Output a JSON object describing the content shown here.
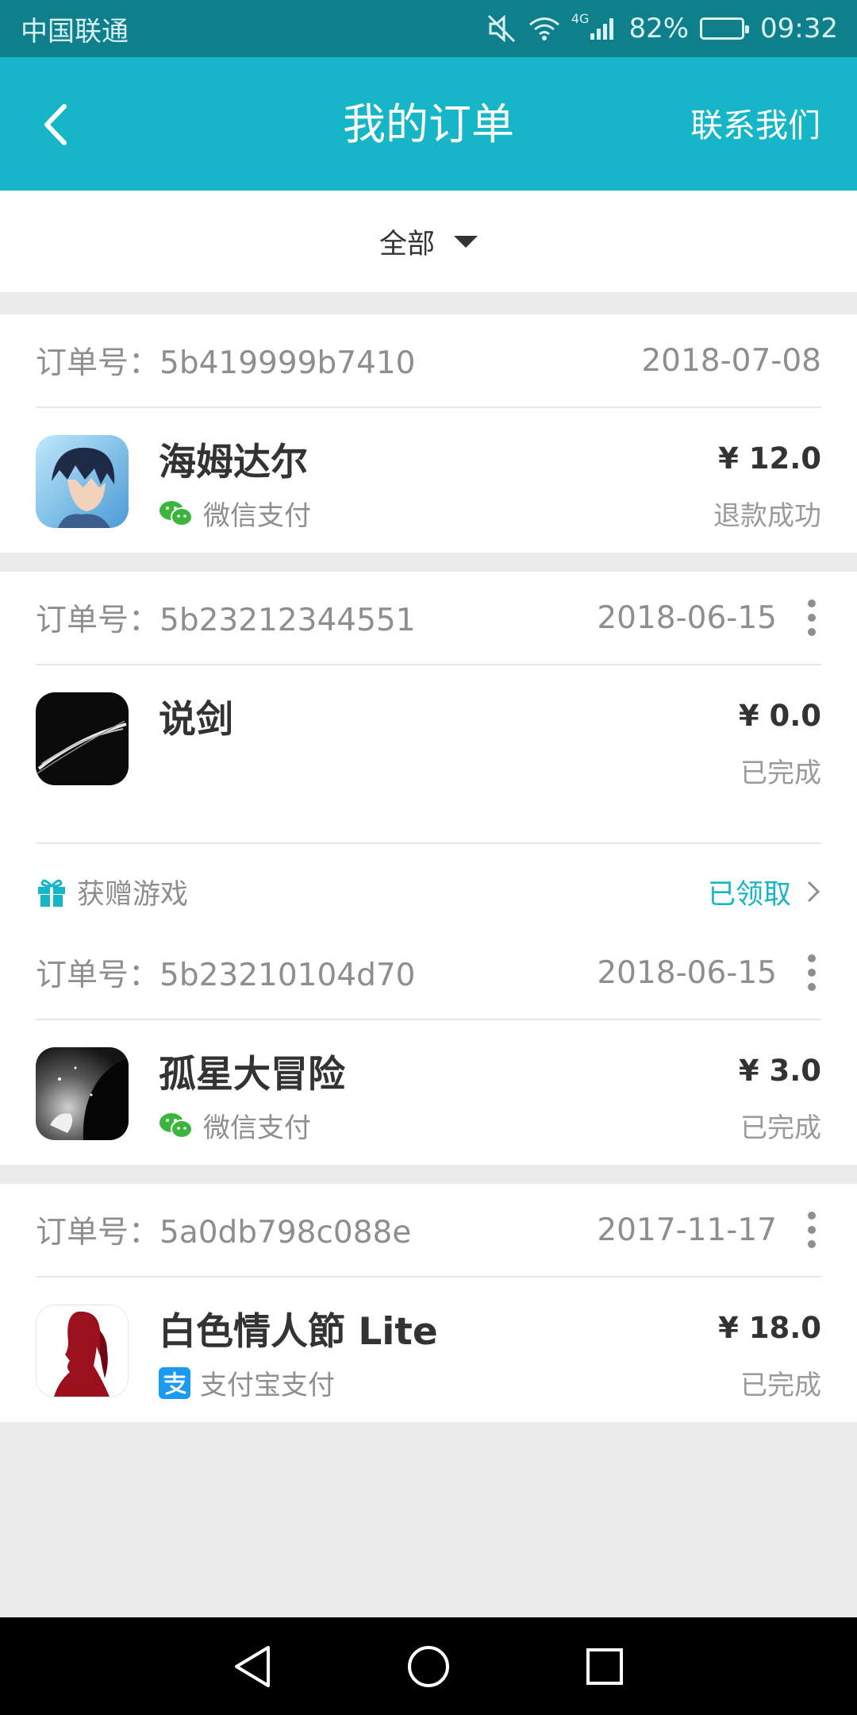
{
  "status_bar": {
    "carrier": "中国联通",
    "network": "4G",
    "battery": "82%",
    "battery_level": 0.82,
    "time": "09:32"
  },
  "header": {
    "title": "我的订单",
    "contact_label": "联系我们"
  },
  "filter": {
    "label": "全部"
  },
  "orders": [
    {
      "order_prefix": "订单号：",
      "order_id": "5b419999b7410",
      "date": "2018-07-08",
      "app_name": "海姆达尔",
      "payment": "微信支付",
      "payment_icon": "wechat-pay-icon",
      "price": "¥ 12.0",
      "status": "退款成功"
    },
    {
      "order_prefix": "订单号：",
      "order_id": "5b23212344551",
      "date": "2018-06-15",
      "app_name": "说剑",
      "price": "¥ 0.0",
      "status": "已完成",
      "gift_label": "获赠游戏",
      "gift_status": "已领取"
    },
    {
      "order_prefix": "订单号：",
      "order_id": "5b23210104d70",
      "date": "2018-06-15",
      "app_name": "孤星大冒险",
      "payment": "微信支付",
      "payment_icon": "wechat-pay-icon",
      "price": "¥ 3.0",
      "status": "已完成"
    },
    {
      "order_prefix": "订单号：",
      "order_id": "5a0db798c088e",
      "date": "2017-11-17",
      "app_name": "白色情人節 Lite",
      "payment": "支付宝支付",
      "payment_icon": "alipay-icon",
      "price": "¥ 18.0",
      "status": "已完成"
    }
  ],
  "colors": {
    "accent": "#17b5c8",
    "status_bar": "#0f7f8c",
    "wechat_green": "#3bb53b",
    "alipay_blue": "#1a9bf0"
  }
}
